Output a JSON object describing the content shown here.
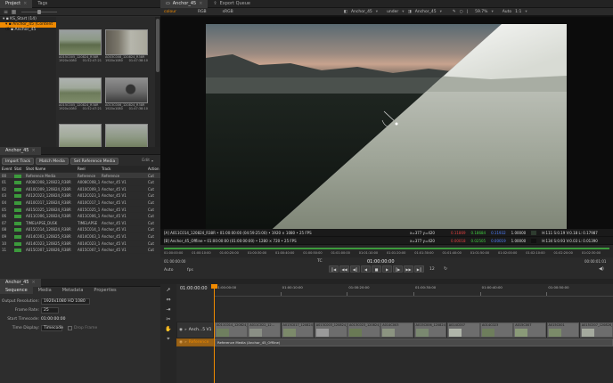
{
  "project_panel": {
    "tabs": [
      "Project",
      "Tags"
    ],
    "tree": [
      {
        "label": "KS_Start (14)"
      },
      {
        "label": "Anchor_45 (Content (8))"
      },
      {
        "label": "Anchor_45"
      }
    ],
    "thumbnails": [
      {
        "name": "A015C005_120824_R38R",
        "res": "1920x1080",
        "tc": "01:52:47:21"
      },
      {
        "name": "A003C008_120824_R38R",
        "res": "1920x1080",
        "tc": "01:47:38:10"
      },
      {
        "name": "A015C005_120824_R38R",
        "res": "1920x1080",
        "tc": "01:52:47:21"
      },
      {
        "name": "A013C006_120824_R38R",
        "res": "1920x1080",
        "tc": "01:47:38:10"
      },
      {
        "name": "",
        "res": "",
        "tc": ""
      },
      {
        "name": "",
        "res": "",
        "tc": ""
      }
    ]
  },
  "event_panel": {
    "tab": "Anchor_45",
    "buttons": [
      "Import Track",
      "Match Media",
      "Set Reference Media"
    ],
    "edit_label": "Edit",
    "columns": [
      "Event",
      "Stat",
      "Shot Name",
      "Reel",
      "Track",
      "Action"
    ],
    "rows": [
      [
        "00",
        "",
        "Reference Media",
        "Reference",
        "Reference",
        "Cut"
      ],
      [
        "01",
        "",
        "A008C008_120823_R38R",
        "A008C008_120823",
        "Anchor_45 V1",
        "Cut"
      ],
      [
        "02",
        "",
        "A010C009_120824_R38R",
        "A010C009_120824",
        "Anchor_45 V1",
        "Cut"
      ],
      [
        "03",
        "",
        "A012C023_120824_R38R",
        "A012C023_120824",
        "Anchor_45 V1",
        "Cut"
      ],
      [
        "04",
        "",
        "A010C017_120824_R38R",
        "A010C017_120824",
        "Anchor_45 V1",
        "Cut"
      ],
      [
        "05",
        "",
        "A015C025_120824_R38R",
        "A015C025_120824",
        "Anchor_45 V1",
        "Cut"
      ],
      [
        "06",
        "",
        "A011C006_120824_R38R",
        "A011C006_120824",
        "Anchor_45 V1",
        "Cut"
      ],
      [
        "07",
        "",
        "TIMELAPSE_DUSK",
        "TIMELAPSE",
        "Anchor_45 V1",
        "Cut"
      ],
      [
        "08",
        "",
        "A015C014_120824_R38R",
        "A015C014_120824",
        "Anchor_45 V1",
        "Cut"
      ],
      [
        "09",
        "",
        "A014C003_120825_R38R",
        "A014C003_120825",
        "Anchor_45 V1",
        "Cut"
      ],
      [
        "10",
        "",
        "A014C023_120825_R38R",
        "A014C023_120825",
        "Anchor_45 V1",
        "Cut"
      ],
      [
        "11",
        "",
        "A015C007_120826_R38R",
        "A015C007_120826",
        "Anchor_45 V1",
        "Cut"
      ]
    ]
  },
  "viewer": {
    "tabs": [
      "Anchor_45",
      "Export Queue"
    ],
    "colour_label": "colour",
    "rgb_label": "RGB",
    "colorspace": "sRGB",
    "source_a": "Anchor_45",
    "wipe_mode": "under",
    "source_b": "Anchor_45",
    "zoom": "59.7%",
    "auto": "Auto",
    "ratio": "1:1",
    "info_a": "[A] A011C014_120824_R38R • 01:00:00:00 (04:59:25:00) • 1920 × 1080 • 25 FPS",
    "info_b": "[B] Anchor_45_Offline • 01:00:00:00 (01:00:00:00) • 1280 × 720 • 25 FPS",
    "coords_a": "x=377 y=420",
    "coords_b": "x=377 y=420",
    "vals_a": [
      "0.11869",
      "0.18684",
      "0.11932",
      "1.00000"
    ],
    "vals_b": [
      "0.00018",
      "0.02505",
      "0.00019",
      "1.00000"
    ],
    "hsl_a": "H:111 S:0.19 V:0.18  L: 0.17987",
    "hsl_b": "H:134 S:0.93 V:0.03  L: 0.01390",
    "ruler_marks": [
      "01:00:00:00",
      "01:00:10:00",
      "01:00:20:00",
      "01:00:30:00",
      "01:00:40:00",
      "01:00:50:00",
      "01:01:00:00",
      "01:01:10:00",
      "01:01:20:00",
      "01:01:30:00",
      "01:01:40:00",
      "01:01:50:00",
      "01:02:00:00",
      "01:02:10:00",
      "01:02:20:00",
      "01:02:30:00"
    ],
    "tc_label": "TC",
    "current_tc": "01:00:00:00",
    "start_tc": "01:00:00:00",
    "end_tc": "00:00:01:01",
    "fps_label": "fps",
    "playback_auto": "Auto",
    "step_value": "12",
    "transport_icons": [
      "┃◀",
      "◀◀",
      "◀┃",
      "◀",
      "■",
      "▶",
      "┃▶",
      "▶▶",
      "▶┃"
    ]
  },
  "sequence_panel": {
    "tab": "Anchor_45",
    "subtabs": [
      "Sequence",
      "Media",
      "Metadata",
      "Properties"
    ],
    "output_resolution_label": "Output Resolution:",
    "output_resolution": "1920x1080 HD 1080",
    "frame_rate_label": "Frame Rate:",
    "frame_rate": "25",
    "start_timecode_label": "Start Timecode:",
    "start_timecode": "01:00:00:00",
    "time_display_label": "Time Display:",
    "time_display": "Timecode",
    "drop_frame_label": "Drop Frame"
  },
  "timeline": {
    "tc_readout": "01:00:00:00",
    "ruler_marks": [
      "01:00:00:00",
      "01:00:10:00",
      "01:00:20:00",
      "01:00:30:00",
      "01:00:40:00",
      "01:00:50:00"
    ],
    "track_v1_label": "Anch...5 V1",
    "track_ref_label": "Reference",
    "clips": [
      "A011C014_120824_R38R",
      "A011C022_12...",
      "A013C017_120824_R38R",
      "A013C003_120824_R38R",
      "A013C023_120824_R38R",
      "A014C003",
      "A015C006_120824_R38",
      "A014C007",
      "A014C023",
      "A015C007",
      "A015C001",
      "A015C007_120826_R38R"
    ],
    "reference_clip": "Reference Media (Anchor_45_Offline)"
  },
  "colors": {
    "accent": "#f08a00",
    "green": "#3c9a3c",
    "blue_sel": "#3c5a8a"
  }
}
